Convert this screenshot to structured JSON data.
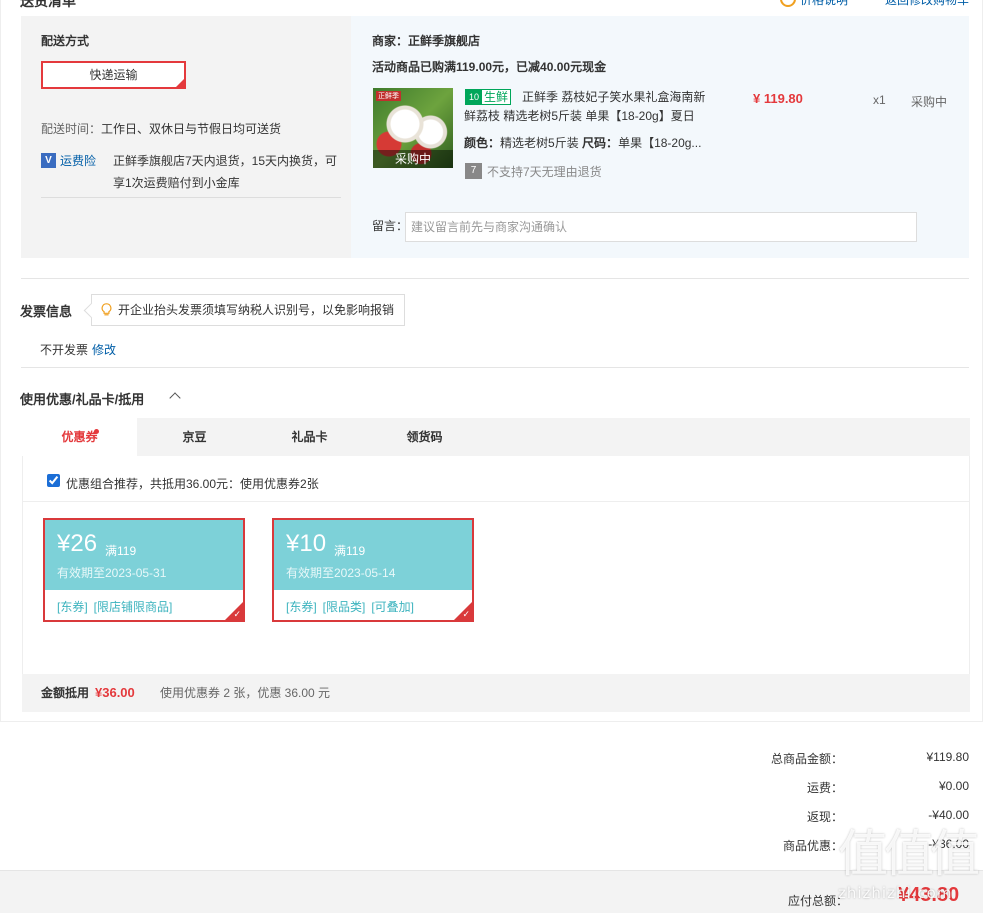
{
  "header": {
    "title": "送货清单",
    "price_note": "价格说明",
    "back_link": "返回修改购物车"
  },
  "shipping": {
    "title": "配送方式",
    "method": "快递运输",
    "time_label": "配送时间：",
    "time_value": "工作日、双休日与节假日均可送货",
    "insurance_icon": "V",
    "insurance_label": "运费险",
    "insurance_desc": "正鲜季旗舰店7天内退货，15天内换货，可享1次运费赔付到小金库"
  },
  "shop": {
    "name": "商家：正鲜季旗舰店",
    "promo": "活动商品已购满119.00元，已减40.00元现金",
    "product": {
      "image_brand": "正鲜季",
      "image_overlay": "采购中",
      "fresh_icon": "10",
      "fresh_tag": "生鲜",
      "title": "正鲜季 荔枝妃子笑水果礼盒海南新鲜荔枝 精选老树5斤装 单果【18-20g】夏日",
      "color_label": "颜色：",
      "color_value": "精选老树5斤装",
      "size_label": "尺码：",
      "size_value": "单果【18-20g...",
      "no_return_icon": "7",
      "no_return": "不支持7天无理由退货",
      "price": "¥ 119.80",
      "qty": "x1",
      "stock": "采购中"
    },
    "note_label": "留言：",
    "note_placeholder": "建议留言前先与商家沟通确认"
  },
  "invoice": {
    "title": "发票信息",
    "tip": "开企业抬头发票须填写纳税人识别号，以免影响报销",
    "status": "不开发票",
    "edit": "修改"
  },
  "coupons": {
    "title": "使用优惠/礼品卡/抵用",
    "tabs": [
      {
        "label": "优惠券"
      },
      {
        "label": "京豆"
      },
      {
        "label": "礼品卡"
      },
      {
        "label": "领货码"
      }
    ],
    "combo_text": "优惠组合推荐，共抵用36.00元：使用优惠券2张",
    "items": [
      {
        "amount": "¥26",
        "condition": "满119",
        "expiry": "有效期至2023-05-31",
        "tags": [
          "[东券]",
          "[限店铺限商品]"
        ]
      },
      {
        "amount": "¥10",
        "condition": "满119",
        "expiry": "有效期至2023-05-14",
        "tags": [
          "[东券]",
          "[限品类]",
          "[可叠加]"
        ]
      }
    ],
    "summary_label": "金额抵用",
    "summary_value": "¥36.00",
    "summary_desc": "使用优惠券 2 张，优惠 36.00 元"
  },
  "totals": {
    "goods_label": "总商品金额：",
    "goods_value": "¥119.80",
    "freight_label": "运费：",
    "freight_value": "¥0.00",
    "rebate_label": "返现：",
    "rebate_value": "-¥40.00",
    "discount_label": "商品优惠：",
    "discount_value": "-¥36.00",
    "pay_label": "应付总额：",
    "pay_value": "¥43.80"
  },
  "watermark": {
    "big": "值值值",
    "small": "zhizhizhi.com"
  },
  "colors": {
    "accent_red": "#e4393c",
    "link_blue": "#005ea7",
    "coupon_teal": "#7dd1d8",
    "fresh_green": "#00a65a"
  }
}
